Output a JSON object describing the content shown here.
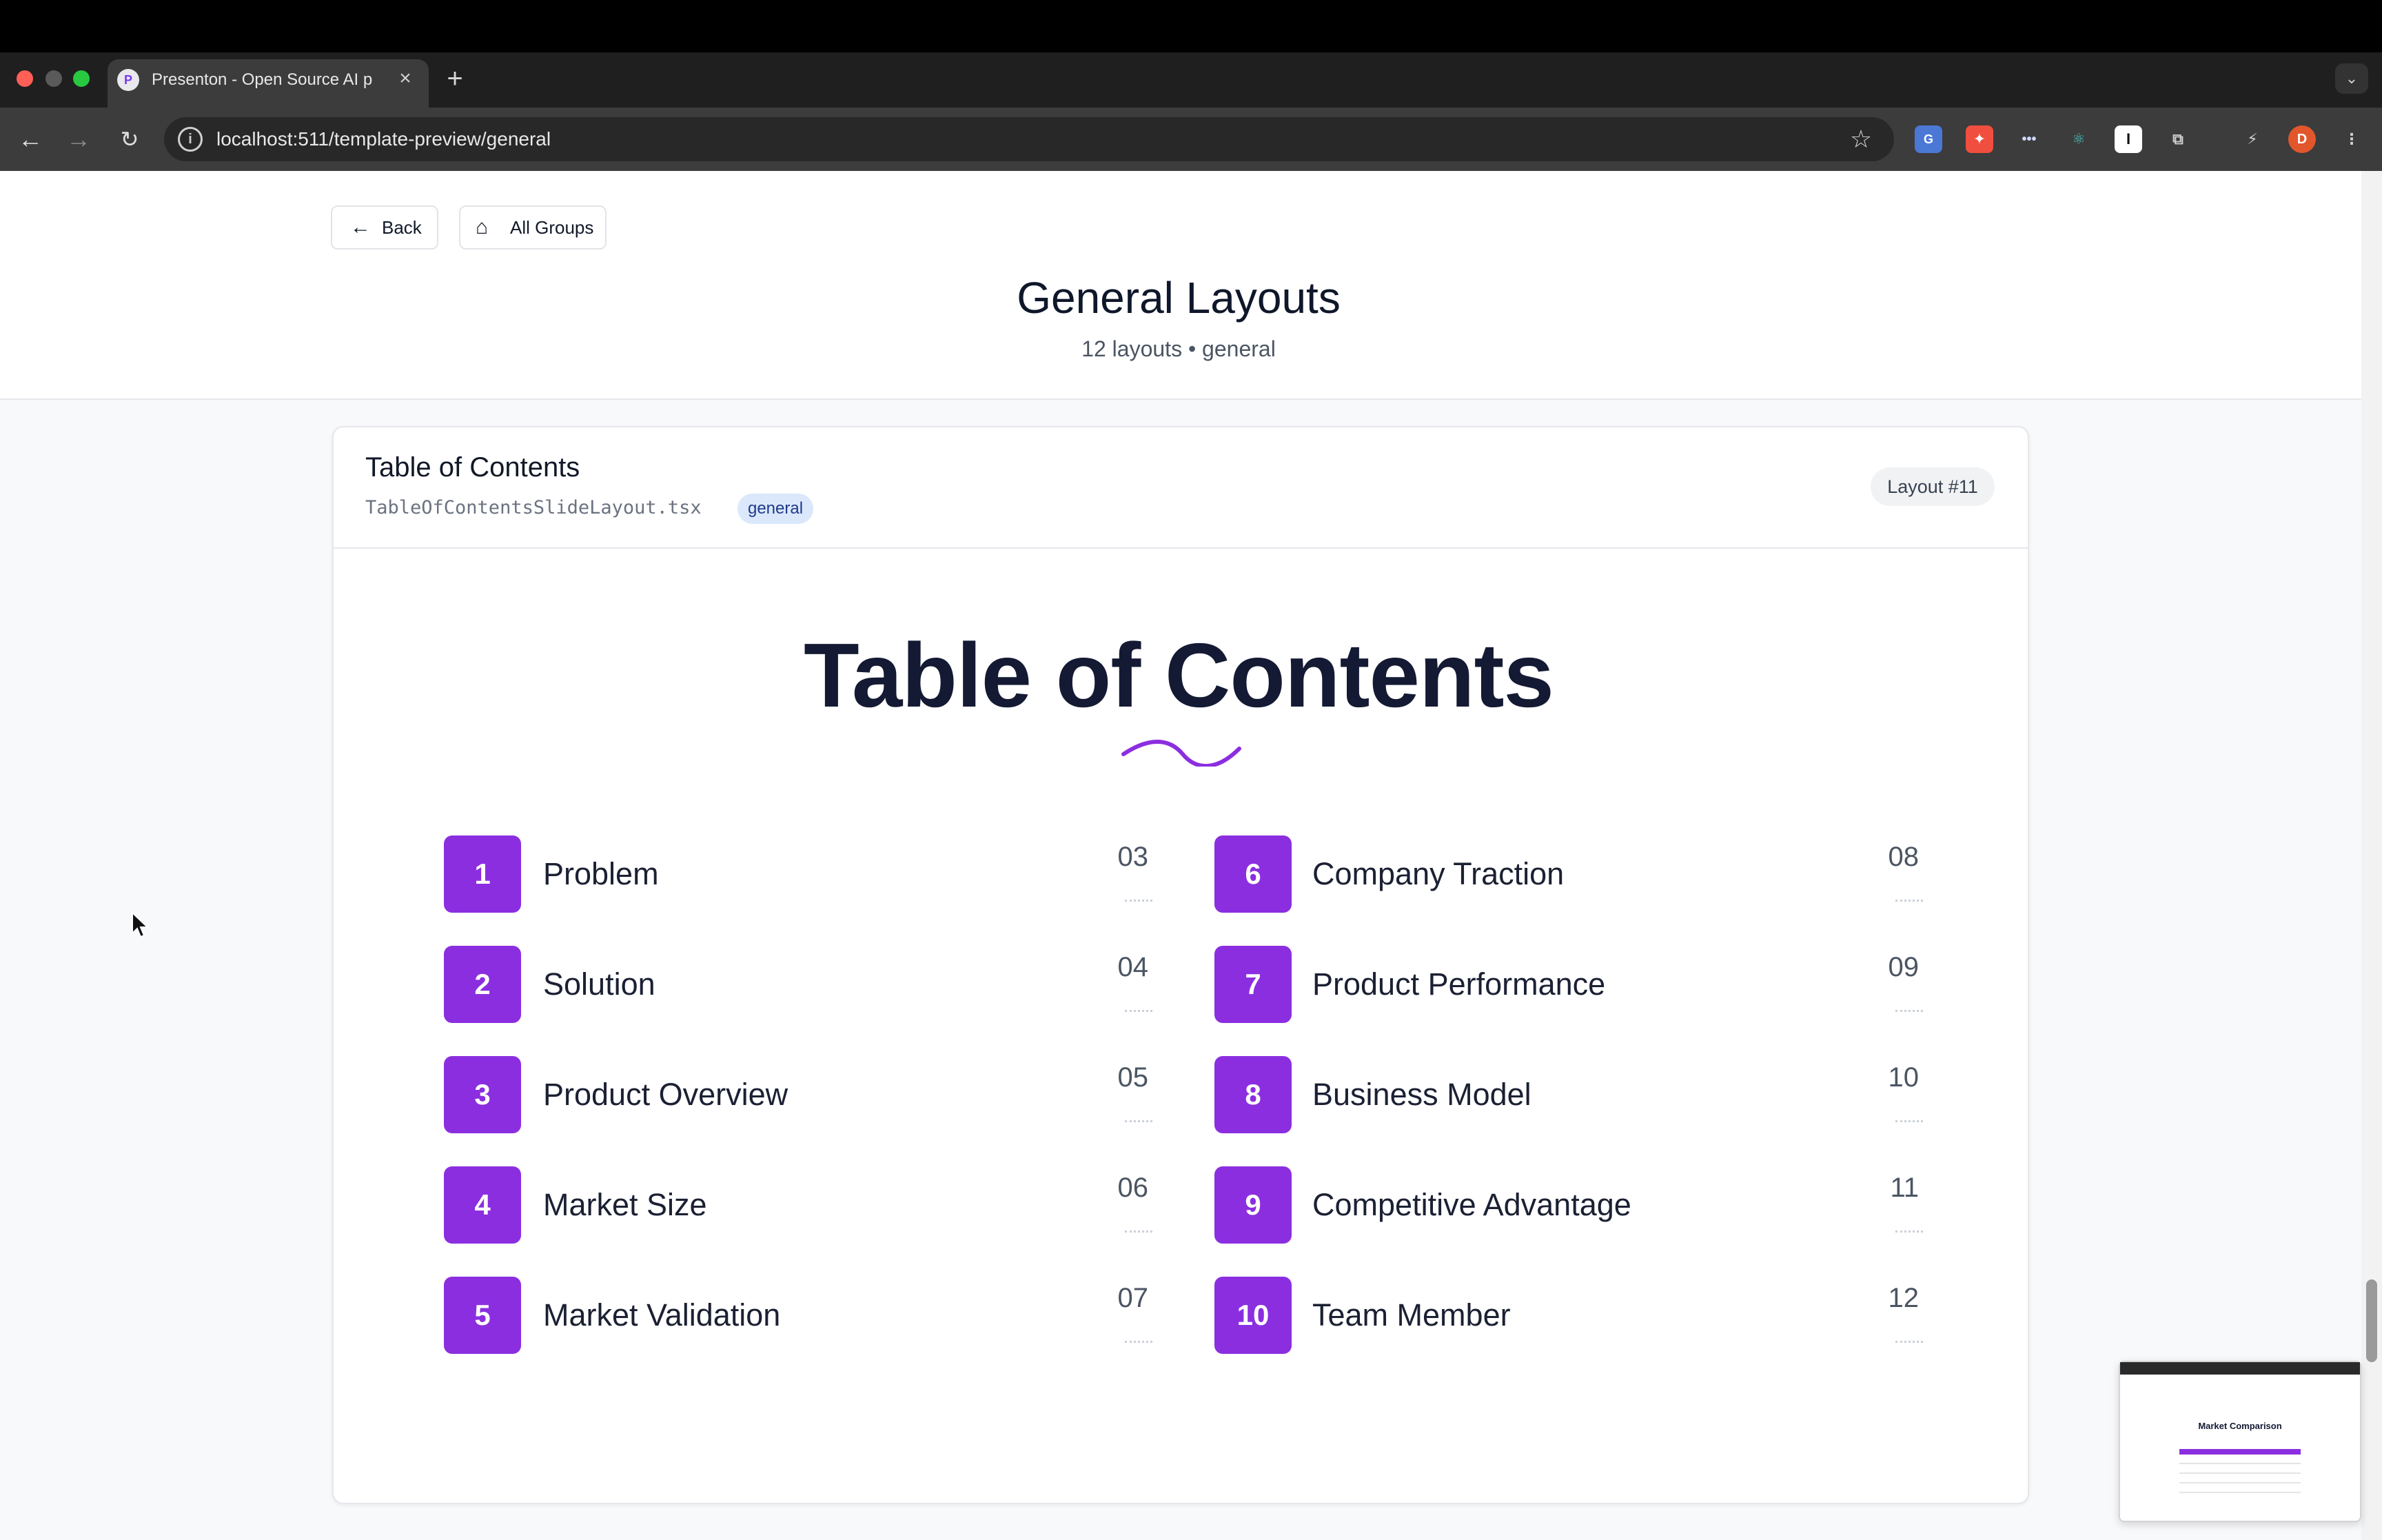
{
  "browser": {
    "tab_title": "Presenton - Open Source AI p",
    "tab_favicon": "P",
    "tab_close": "×",
    "new_tab": "+",
    "tab_menu": "⌄",
    "url": "localhost:511/template-preview/general",
    "profile_initial": "D",
    "colors": {
      "chrome_dark": "#1f1f1f",
      "toolbar": "#3c3c3c"
    }
  },
  "header": {
    "back_label": "Back",
    "all_groups_label": "All Groups",
    "title": "General Layouts",
    "subtitle": "12 layouts • general"
  },
  "card": {
    "title": "Table of Contents",
    "file": "TableOfContentsSlideLayout.tsx",
    "tag": "general",
    "layout_number": "Layout #11"
  },
  "slide": {
    "title": "Table of Contents",
    "accent_color": "#8b2ee0",
    "items": [
      {
        "number": "1",
        "label": "Problem",
        "page": "03"
      },
      {
        "number": "2",
        "label": "Solution",
        "page": "04"
      },
      {
        "number": "3",
        "label": "Product Overview",
        "page": "05"
      },
      {
        "number": "4",
        "label": "Market Size",
        "page": "06"
      },
      {
        "number": "5",
        "label": "Market Validation",
        "page": "07"
      },
      {
        "number": "6",
        "label": "Company Traction",
        "page": "08"
      },
      {
        "number": "7",
        "label": "Product Performance",
        "page": "09"
      },
      {
        "number": "8",
        "label": "Business Model",
        "page": "10"
      },
      {
        "number": "9",
        "label": "Competitive Advantage",
        "page": "11"
      },
      {
        "number": "10",
        "label": "Team Member",
        "page": "12"
      }
    ]
  },
  "thumbnail": {
    "title": "Market Comparison"
  }
}
